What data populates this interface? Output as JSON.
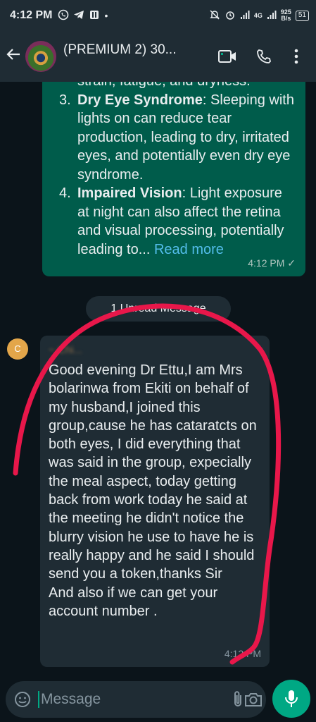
{
  "status": {
    "time": "4:12 PM",
    "net_speed_value": "925",
    "net_speed_unit": "B/s",
    "network": "4G",
    "battery": "51"
  },
  "header": {
    "title": "(PREMIUM 2) 30...",
    "subtitle": ""
  },
  "outgoing": {
    "cut_line": "strain, fatigue, and dryness.",
    "items": [
      {
        "num": "3.",
        "heading": "Dry Eye Syndrome",
        "text": ": Sleeping with lights on can reduce tear production, leading to dry, irritated eyes, and potentially even dry eye syndrome."
      },
      {
        "num": "4.",
        "heading": "Impaired Vision",
        "text": ": Light exposure at night can also affect the retina and visual processing, potentially leading to... "
      }
    ],
    "read_more": "Read more",
    "time": "4:12 PM",
    "tick": "✓"
  },
  "unread_label": "1 Unread Message",
  "incoming": {
    "avatar_letter": "C",
    "sender": "~ Chi...",
    "text": "Good evening Dr Ettu,I am Mrs bolarinwa from Ekiti on behalf of my husband,I joined this group,cause he has cataratcts on both eyes, I did everything that was said in the group, expecially the meal aspect, today getting back from work today he said at the meeting he didn't notice the blurry vision he use to have he is really happy and he said I should send you a token,thanks Sir\nAnd also if we can get your account number .",
    "time": "4:12 PM"
  },
  "input": {
    "placeholder": "Message"
  },
  "colors": {
    "outgoing_bubble": "#005c4b",
    "incoming_bubble": "#1f2c34",
    "accent": "#00a884",
    "scribble": "#e8174a"
  }
}
